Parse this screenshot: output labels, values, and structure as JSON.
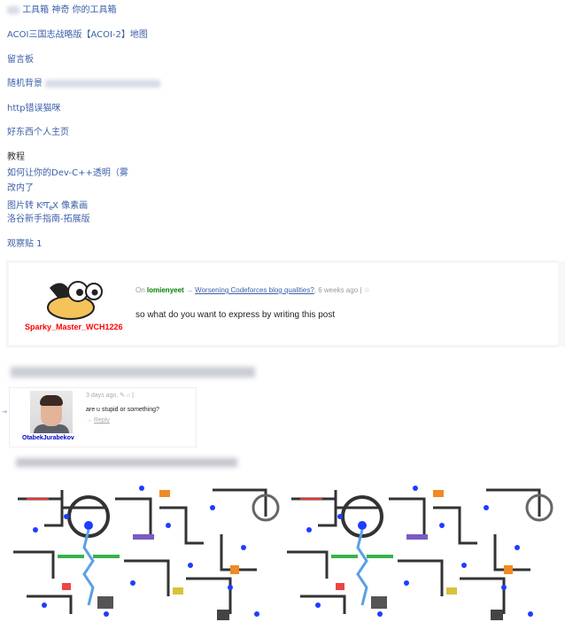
{
  "links": [
    {
      "id": "link-toolbox",
      "text": "工具箱 神奇 你的工具箱",
      "blur_prefix": true
    },
    {
      "id": "link-acoi",
      "text": "ACOI三国志战略版【ACOI-2】地图"
    },
    {
      "id": "link-guestbook",
      "text": "留言板"
    },
    {
      "id": "link-random-bg",
      "text": "随机背景"
    },
    {
      "id": "link-http-cat",
      "text": "http错误猫咪"
    },
    {
      "id": "link-homepage",
      "text": "好东西个人主页"
    }
  ],
  "tutorials": {
    "heading": "教程",
    "items": [
      "如何让你的Dev-C++透明（雾",
      "改内了",
      "图片转 像素画",
      "洛谷新手指南-拓展版"
    ],
    "tex_word": "KaTeX"
  },
  "view_post": "观察贴 1",
  "comment1": {
    "username": "Sparky_Master_WCH1226",
    "meta_on": "On",
    "meta_user": "lomienyeet",
    "meta_arrow": "→",
    "meta_post": "Worsening Codeforces blog qualities?",
    "meta_time": ", 6 weeks ago",
    "meta_sep": "|",
    "text": "so what do you want to express by writing this post"
  },
  "comment2": {
    "username": "OtabekJurabekov",
    "meta": "3 days ago,",
    "text": "are u stupid or something?",
    "reply": "Reply",
    "reply_arrow": "→"
  },
  "arrow_small": "→",
  "colors": {
    "link": "#3b5fa8",
    "username1": "#ff0000",
    "username2": "#0000cc",
    "meta_user": "#008000"
  }
}
